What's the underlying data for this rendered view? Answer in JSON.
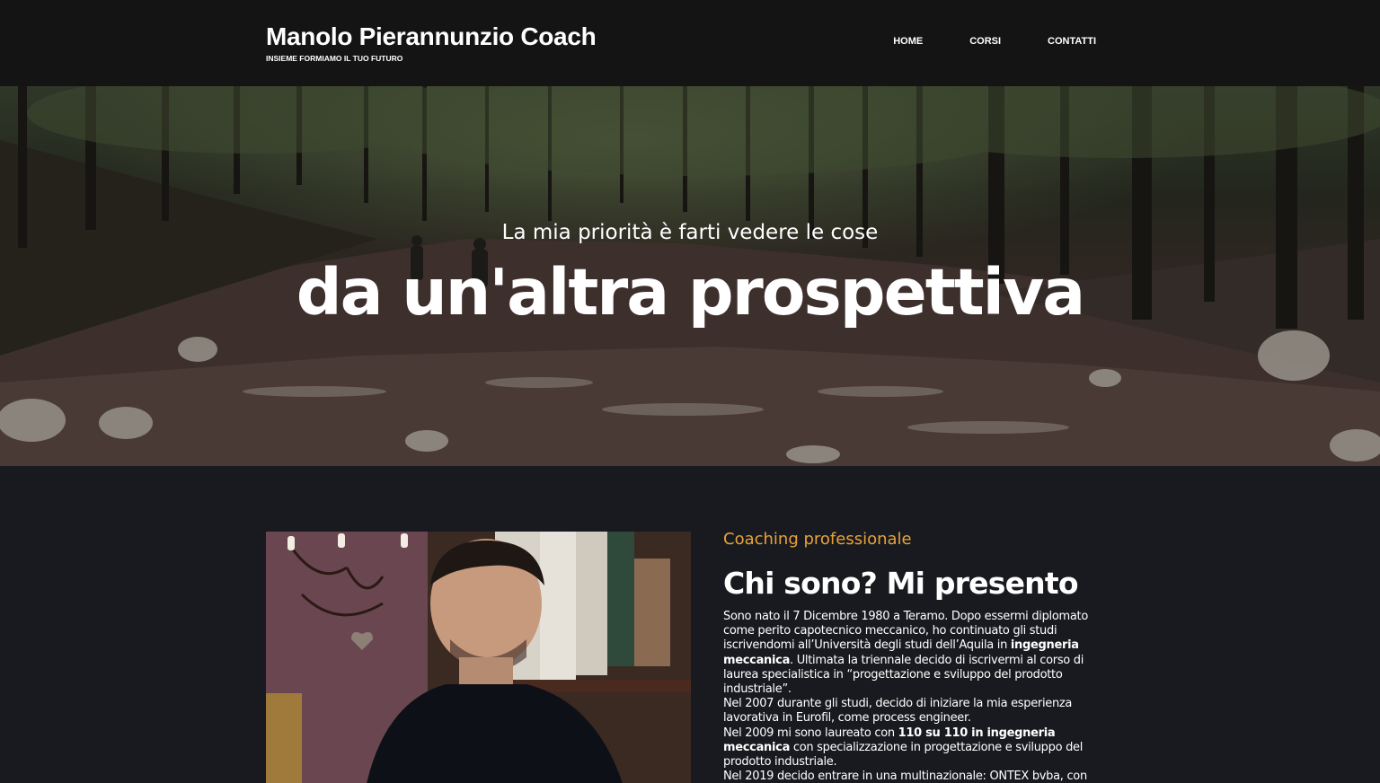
{
  "header": {
    "title": "Manolo Pierannunzio Coach",
    "tagline": "INSIEME FORMIAMO IL TUO FUTURO",
    "nav": [
      {
        "label": "HOME"
      },
      {
        "label": "CORSI"
      },
      {
        "label": "CONTATTI"
      }
    ]
  },
  "hero": {
    "subtitle": "La mia priorità è farti vedere le cose",
    "title": "da un'altra prospettiva"
  },
  "about": {
    "kicker": "Coaching professionale",
    "title": "Chi sono? Mi presento",
    "bio": {
      "p1a": "Sono nato il 7 Dicembre 1980 a Teramo. Dopo essermi diplomato come perito capotecnico meccanico, ho continuato gli studi iscrivendomi all’Università degli studi dell’Aquila in ",
      "p1b": "ingegneria meccanica",
      "p1c": ". Ultimata la triennale decido di iscrivermi al corso di laurea specialistica in  “progettazione e sviluppo del prodotto industriale”.",
      "p2": "Nel 2007 durante gli studi, decido di iniziare la mia esperienza lavorativa in Eurofil, come process engineer.",
      "p3a": "Nel 2009 mi sono laureato con ",
      "p3b": "110 su 110 in ingegneria meccanica",
      "p3c": " con specializzazione in progettazione e sviluppo del prodotto industriale.",
      "p4": "Nel 2019 decido entrare in una multinazionale: ONTEX bvba, con"
    }
  },
  "colors": {
    "header_bg": "#141414",
    "page_bg": "#181a1f",
    "accent": "#e8a23b"
  }
}
